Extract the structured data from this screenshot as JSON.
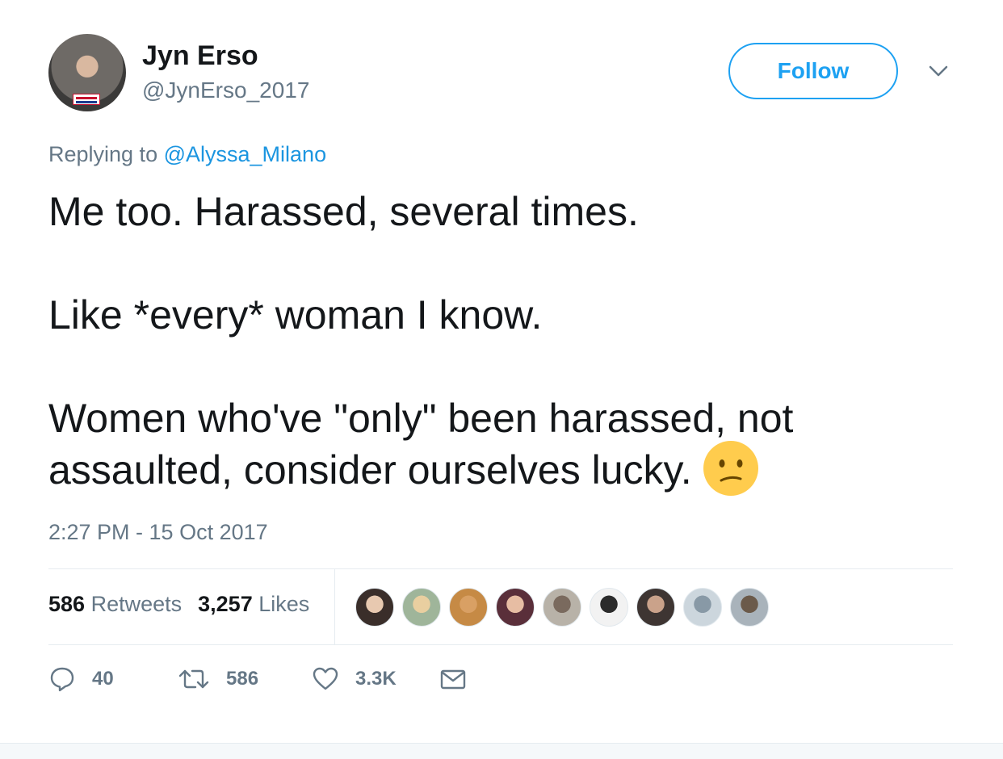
{
  "header": {
    "display_name": "Jyn Erso",
    "handle": "@JynErso_2017",
    "follow_label": "Follow",
    "menu_icon": "chevron-down-icon"
  },
  "reply": {
    "prefix": "Replying to",
    "mention": "@Alyssa_Milano"
  },
  "tweet": {
    "paragraphs": [
      "Me too. Harassed, several times.",
      "Like *every* woman I know.",
      "Women who've \"only\" been harassed, not assaulted, consider ourselves lucky."
    ],
    "emoji": "confused-face-icon",
    "timestamp": "2:27 PM - 15 Oct 2017"
  },
  "stats": {
    "retweets_count": "586",
    "retweets_label": "Retweets",
    "likes_count": "3,257",
    "likes_label": "Likes"
  },
  "likers": [
    {
      "name": "liker-avatar-1",
      "bg": "#3a2e2a",
      "face": "#e8c9b0"
    },
    {
      "name": "liker-avatar-2",
      "bg": "#9fb59a",
      "face": "#e9cfa0"
    },
    {
      "name": "liker-avatar-3",
      "bg": "#c68a45",
      "face": "#d9a064"
    },
    {
      "name": "liker-avatar-4",
      "bg": "#5a2f3a",
      "face": "#e7bda3"
    },
    {
      "name": "liker-avatar-5",
      "bg": "#b8b2a8",
      "face": "#7a6a5e"
    },
    {
      "name": "liker-avatar-6",
      "bg": "#f2f2f2",
      "face": "#2b2b2b"
    },
    {
      "name": "liker-avatar-7",
      "bg": "#3e3532",
      "face": "#caa28a"
    },
    {
      "name": "liker-avatar-8",
      "bg": "#ccd6dd",
      "face": "#8899a6"
    },
    {
      "name": "liker-avatar-9",
      "bg": "#a9b3bb",
      "face": "#6b5a4a"
    }
  ],
  "actions": {
    "reply_count": "40",
    "retweet_count": "586",
    "like_count": "3.3K"
  },
  "colors": {
    "accent": "#1da1f2",
    "text": "#14171a",
    "secondary": "#657786",
    "emoji": "#ffcc4d"
  }
}
